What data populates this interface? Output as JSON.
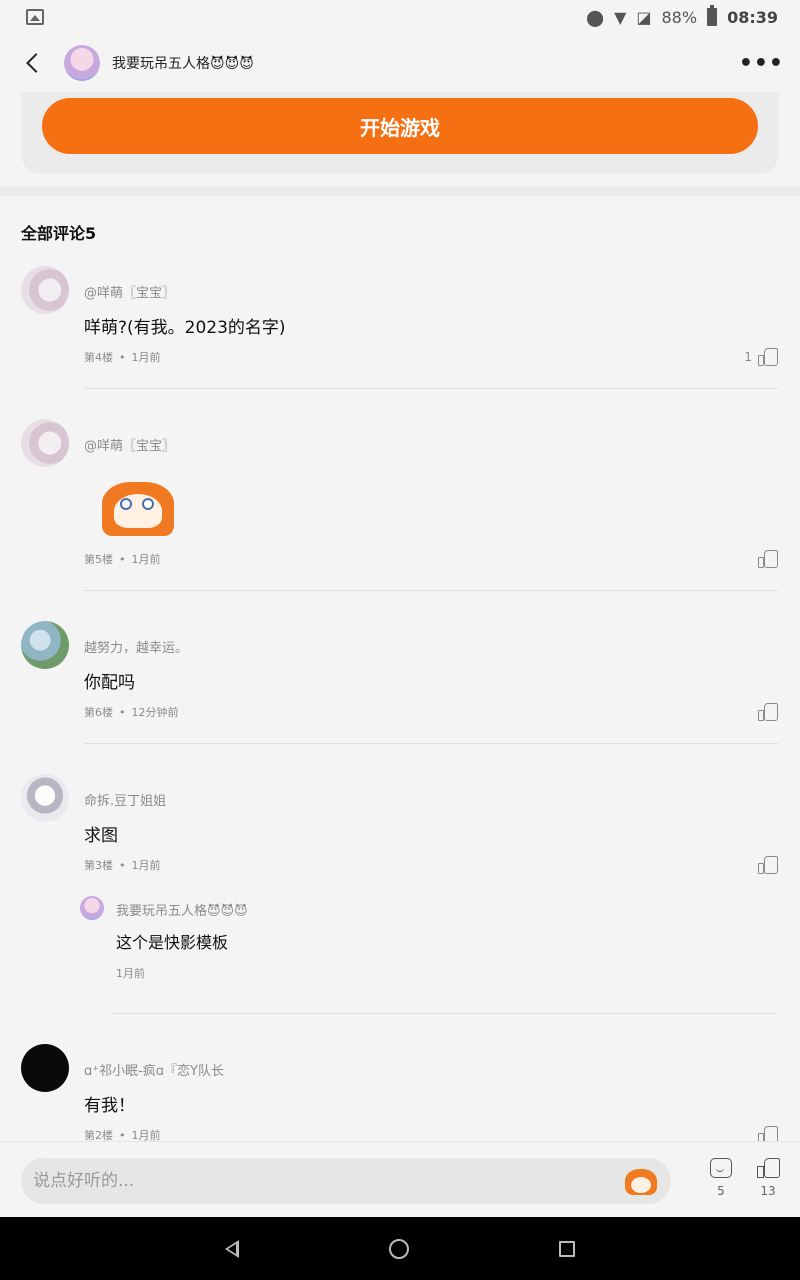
{
  "status_bar": {
    "battery": "88%",
    "time": "08:39"
  },
  "header": {
    "title": "我要玩吊五人格😈😈😈",
    "more": "•••"
  },
  "game": {
    "start_label": "开始游戏"
  },
  "comments_section": {
    "title": "全部评论5"
  },
  "comments": [
    {
      "user": "@咩萌〖宝宝〗",
      "text": "咩萌?(有我。2023的名字)",
      "floor": "第4楼",
      "time": "1月前",
      "likes": "1"
    },
    {
      "user": "@咩萌〖宝宝〗",
      "text": "",
      "floor": "第5楼",
      "time": "1月前",
      "likes": ""
    },
    {
      "user": "越努力，越幸运。",
      "text": "你配吗",
      "floor": "第6楼",
      "time": "12分钟前",
      "likes": ""
    },
    {
      "user": "命拆.豆丁姐姐",
      "text": "求图",
      "floor": "第3楼",
      "time": "1月前",
      "likes": "",
      "reply": {
        "user": "我要玩吊五人格😈😈😈",
        "text": "这个是快影模板",
        "time": "1月前"
      }
    },
    {
      "user": "ɑ⁺祁小眠-疯ɑ『恋Y队长",
      "text": "有我！",
      "floor": "第2楼",
      "time": "1月前",
      "likes": ""
    }
  ],
  "bottom_bar": {
    "placeholder": "说点好听的...",
    "comment_count": "5",
    "like_count": "13"
  }
}
